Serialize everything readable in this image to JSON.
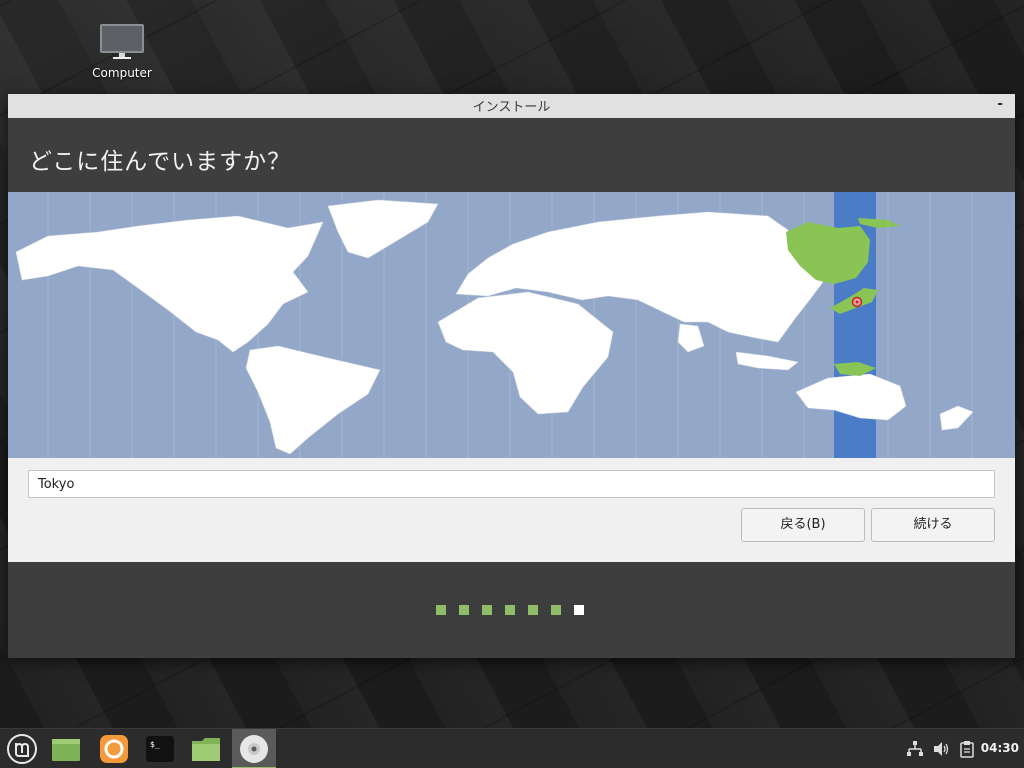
{
  "desktop": {
    "icons": [
      {
        "label": "Computer",
        "icon": "computer-icon"
      }
    ]
  },
  "window": {
    "title": "インストール",
    "minimize_glyph": "-",
    "heading": "どこに住んでいますか？",
    "timezone": {
      "value": "Tokyo"
    },
    "buttons": {
      "back_label": "戻る(B)",
      "continue_label": "続ける"
    },
    "progress": {
      "total_steps": 7,
      "current_step": 7
    },
    "map": {
      "selected_zone_color": "#4a7cc8",
      "land_color": "#ffffff",
      "ocean_color": "#93a8c9",
      "highlight_land_color": "#8ac454",
      "marker_city": "Tokyo"
    }
  },
  "taskbar": {
    "items": [
      {
        "name": "menu-icon",
        "active": false
      },
      {
        "name": "show-desktop-icon",
        "active": false
      },
      {
        "name": "firefox-icon",
        "active": false
      },
      {
        "name": "terminal-icon",
        "active": false
      },
      {
        "name": "files-icon",
        "active": false
      },
      {
        "name": "installer-disc-icon",
        "active": true
      }
    ],
    "tray": [
      "network-icon",
      "volume-icon",
      "clipboard-icon"
    ],
    "clock": "04:30",
    "accent": "#8fbd68"
  }
}
